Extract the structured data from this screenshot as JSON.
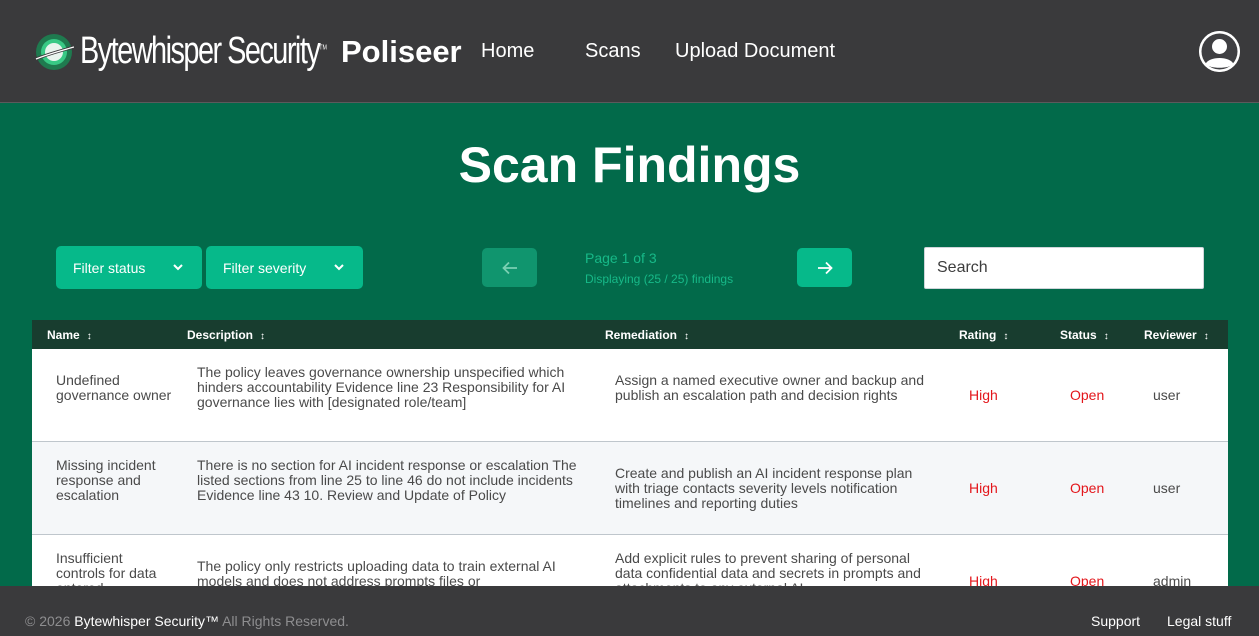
{
  "brand": {
    "name": "Bytewhisper Security",
    "trademark": "TM",
    "app_name": "Poliseer"
  },
  "nav": {
    "home": "Home",
    "scans": "Scans",
    "upload": "Upload Document",
    "avatar_icon": "user-avatar-icon"
  },
  "page": {
    "title": "Scan Findings"
  },
  "controls": {
    "filter_status": "Filter status",
    "filter_severity": "Filter severity",
    "page_info": "Page 1 of 3",
    "display_info": "Displaying (25 / 25) findings",
    "search_placeholder": "Search"
  },
  "table": {
    "headers": {
      "name": "Name",
      "description": "Description",
      "remediation": "Remediation",
      "rating": "Rating",
      "status": "Status",
      "reviewer": "Reviewer"
    },
    "rows": [
      {
        "name": "Undefined governance owner",
        "description": "The policy leaves governance ownership unspecified which hinders accountability Evidence line 23 Responsibility for AI governance lies with [designated role/team]",
        "remediation": "Assign a named executive owner and backup and publish an escalation path and decision rights",
        "rating": "High",
        "status": "Open",
        "reviewer": "user"
      },
      {
        "name": "Missing incident response and escalation",
        "description": "There is no section for AI incident response or escalation The listed sections from line 25 to line 46 do not include incidents Evidence line 43 10. Review and Update of Policy",
        "remediation": "Create and publish an AI incident response plan with triage contacts severity levels notification timelines and reporting duties",
        "rating": "High",
        "status": "Open",
        "reviewer": "user"
      },
      {
        "name": "Insufficient controls for data entered",
        "description": "The policy only restricts uploading data to train external AI models and does not address prompts files or",
        "remediation": "Add explicit rules to prevent sharing of personal data confidential data and secrets in prompts and attachments to any external AI",
        "rating": "High",
        "status": "Open",
        "reviewer": "admin"
      }
    ]
  },
  "footer": {
    "copyright_prefix": "© 2026",
    "brand": "Bytewhisper Security™",
    "rights": "All Rights Reserved.",
    "support": "Support",
    "legal": "Legal stuff"
  },
  "colors": {
    "page_bg": "#026a4a",
    "nav_bg": "#3a3a3c",
    "accent": "#06b98a",
    "table_header_bg": "#183d2f",
    "danger": "#e3161b"
  }
}
